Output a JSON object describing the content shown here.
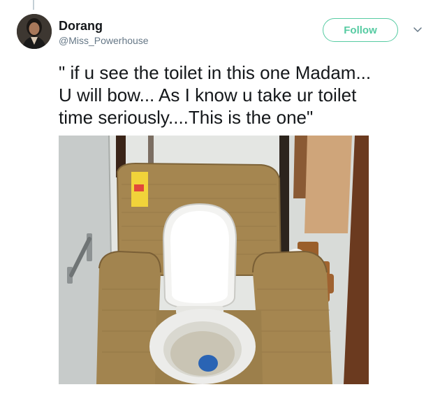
{
  "author": {
    "display_name": "Dorang",
    "handle": "@Miss_Powerhouse"
  },
  "actions": {
    "follow_label": "Follow"
  },
  "tweet": {
    "text": "\" if u see the toilet in this one Madam...\nU will bow... As I know u take ur toilet\ntime seriously....This is the one\""
  },
  "icons": {
    "menu": "chevron-down-icon"
  },
  "colors": {
    "follow_accent": "#56cba2",
    "handle_gray": "#657786",
    "text": "#14171a"
  }
}
